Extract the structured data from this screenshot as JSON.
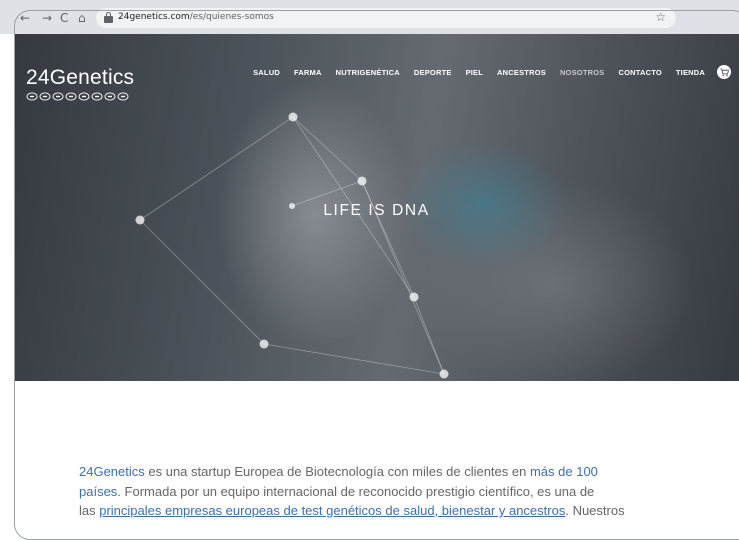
{
  "browser": {
    "url_domain": "24genetics.com",
    "url_path": "/es/quienes-somos",
    "nav_back": "←",
    "nav_forward": "→",
    "nav_reload": "C",
    "nav_home": "⌂",
    "star": "☆"
  },
  "header": {
    "logo_text": "24Genetics",
    "nav": [
      {
        "label": "SALUD"
      },
      {
        "label": "FARMA"
      },
      {
        "label": "NUTRIGENÉTICA"
      },
      {
        "label": "DEPORTE"
      },
      {
        "label": "PIEL"
      },
      {
        "label": "ANCESTROS"
      },
      {
        "label": "NOSOTROS",
        "active": true
      },
      {
        "label": "CONTACTO"
      },
      {
        "label": "TIENDA"
      }
    ],
    "cart_icon": "cart-icon"
  },
  "hero": {
    "title": "LIFE IS DNA"
  },
  "content": {
    "line1": {
      "link1": "24Genetics",
      "text1": " es una startup Europea de Biotecnología con miles de clientes en ",
      "link2": "más de 100"
    },
    "line2": {
      "link1": "países.",
      "text1": " Formada por un equipo internacional de reconocido prestigio científico, es una de"
    },
    "line3": {
      "text1": "las ",
      "link1": "principales empresas europeas de test genéticos de salud, bienestar y ancestros",
      "text2": ". Nuestros"
    }
  },
  "colors": {
    "link": "#3d6fae",
    "body_text": "#666666",
    "nav_active": "#c5c8cc"
  }
}
